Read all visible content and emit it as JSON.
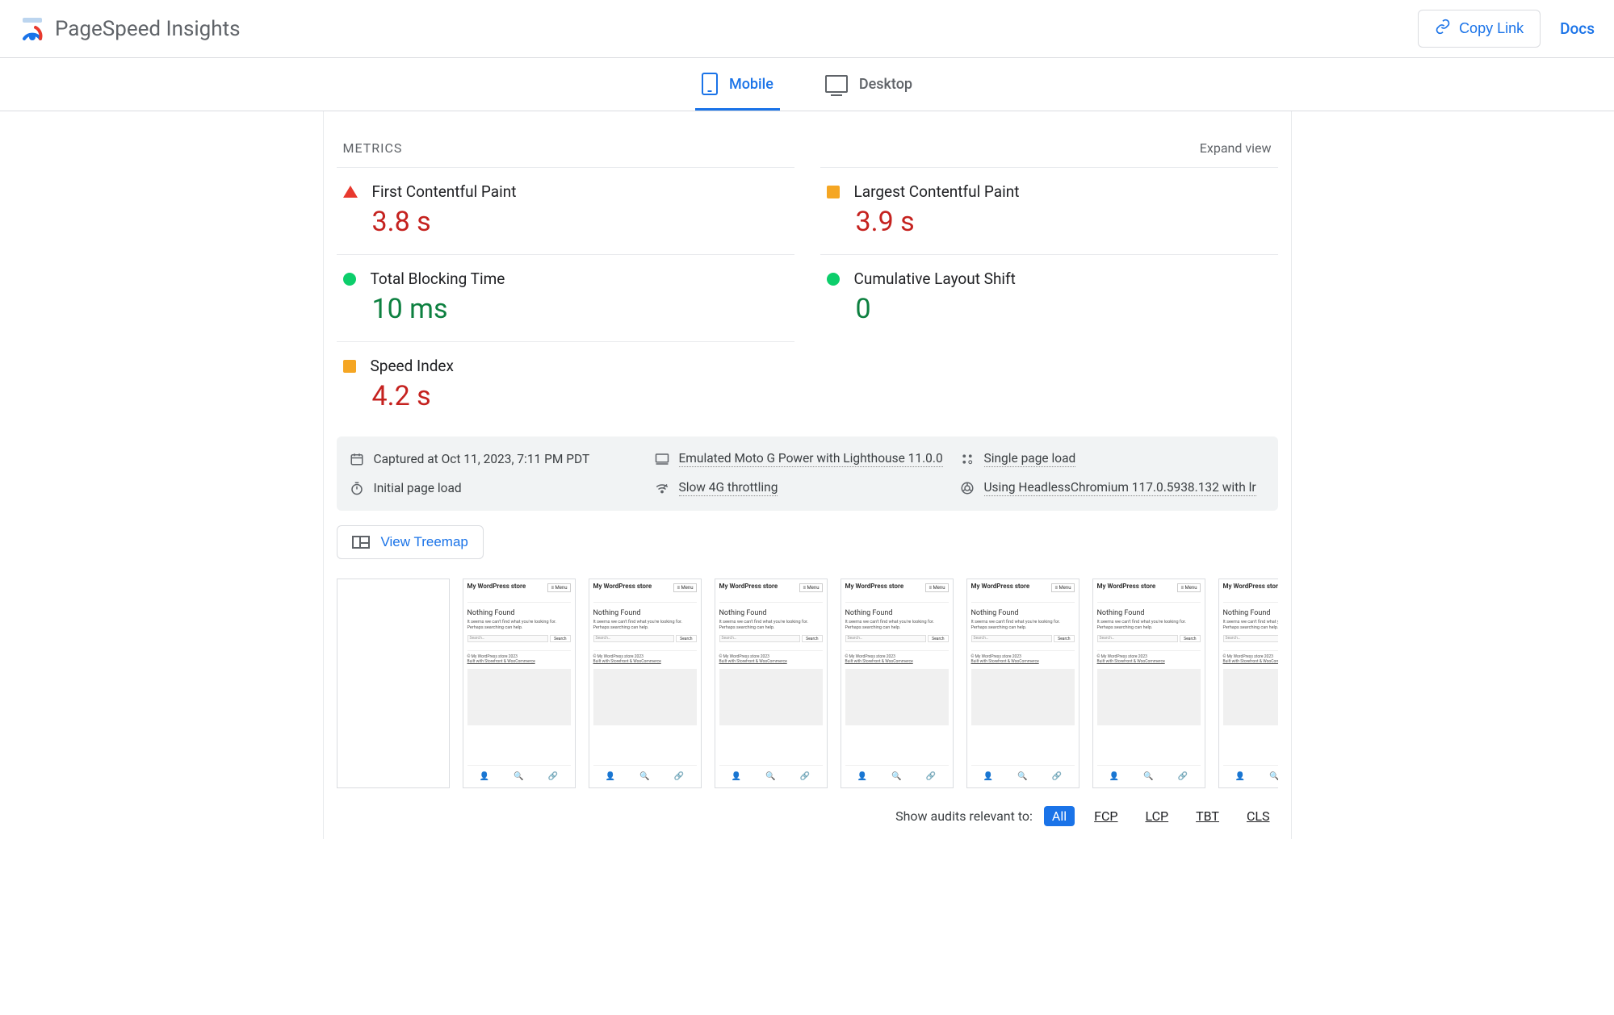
{
  "header": {
    "app_title": "PageSpeed Insights",
    "copy_link": "Copy Link",
    "docs": "Docs"
  },
  "tabs": {
    "mobile": "Mobile",
    "desktop": "Desktop",
    "active": "mobile"
  },
  "metrics_section": {
    "title": "METRICS",
    "expand": "Expand view"
  },
  "metrics": [
    {
      "label": "First Contentful Paint",
      "value": "3.8 s",
      "status": "fail",
      "value_color": "red"
    },
    {
      "label": "Largest Contentful Paint",
      "value": "3.9 s",
      "status": "average",
      "value_color": "red"
    },
    {
      "label": "Total Blocking Time",
      "value": "10 ms",
      "status": "pass",
      "value_color": "green"
    },
    {
      "label": "Cumulative Layout Shift",
      "value": "0",
      "status": "pass",
      "value_color": "green"
    },
    {
      "label": "Speed Index",
      "value": "4.2 s",
      "status": "average",
      "value_color": "red"
    }
  ],
  "env": {
    "captured": "Captured at Oct 11, 2023, 7:11 PM PDT",
    "device": "Emulated Moto G Power with Lighthouse 11.0.0",
    "sampling": "Single page load",
    "load_type": "Initial page load",
    "network": "Slow 4G throttling",
    "browser": "Using HeadlessChromium 117.0.5938.132 with lr"
  },
  "treemap_label": "View Treemap",
  "filmstrip": {
    "frame_title": "My WordPress store",
    "menu": "≡ Menu",
    "not_found": "Nothing Found",
    "desc": "It seems we can't find what you're looking for. Perhaps searching can help.",
    "search_placeholder": "Search…",
    "search_btn": "Search",
    "footer_c": "© My WordPress store 2023",
    "footer_b": "Built with Storefront & WooCommerce"
  },
  "audits_filter": {
    "label": "Show audits relevant to:",
    "options": [
      "All",
      "FCP",
      "LCP",
      "TBT",
      "CLS"
    ],
    "active": "All"
  }
}
